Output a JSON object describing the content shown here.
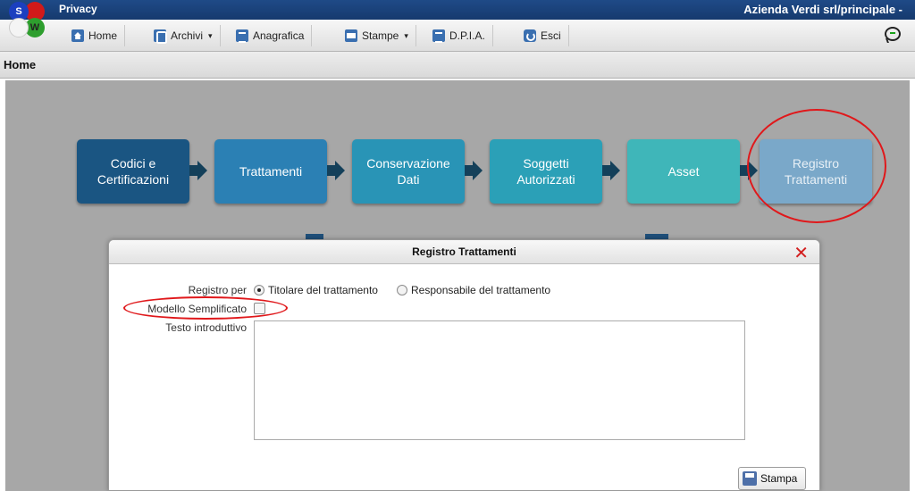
{
  "window": {
    "app_title": "Privacy",
    "company": "Azienda Verdi srl/principale -"
  },
  "logo": {
    "letter_s": "S",
    "letter_w": "W"
  },
  "toolbar": {
    "home": "Home",
    "archivi": "Archivi",
    "anagrafica": "Anagrafica",
    "stampe": "Stampe",
    "dpia": "D.P.I.A.",
    "esci": "Esci",
    "caret": "▾"
  },
  "breadcrumb": "Home",
  "process": {
    "codici": "Codici e Certificazioni",
    "trattamenti": "Trattamenti",
    "conservazione": "Conservazione Dati",
    "soggetti": "Soggetti Autorizzati",
    "asset": "Asset",
    "registro": "Registro Trattamenti"
  },
  "dialog": {
    "title": "Registro Trattamenti",
    "close": "✕",
    "registro_per_label": "Registro per",
    "option_titolare": "Titolare del trattamento",
    "option_responsabile": "Responsabile del trattamento",
    "selected_option": "Titolare del trattamento",
    "modello_label": "Modello Semplificato",
    "modello_checked": false,
    "testo_label": "Testo introduttivo",
    "testo_value": "",
    "stampa_label": "Stampa"
  },
  "colors": {
    "tile_codici": "#1a5582",
    "tile_trattamenti": "#2b80b4",
    "tile_conservazione": "#2994b6",
    "tile_soggetti": "#2ba0b7",
    "tile_asset": "#3fb6b9",
    "tile_registro": "#7aa8c9",
    "highlight": "#e0181b"
  }
}
